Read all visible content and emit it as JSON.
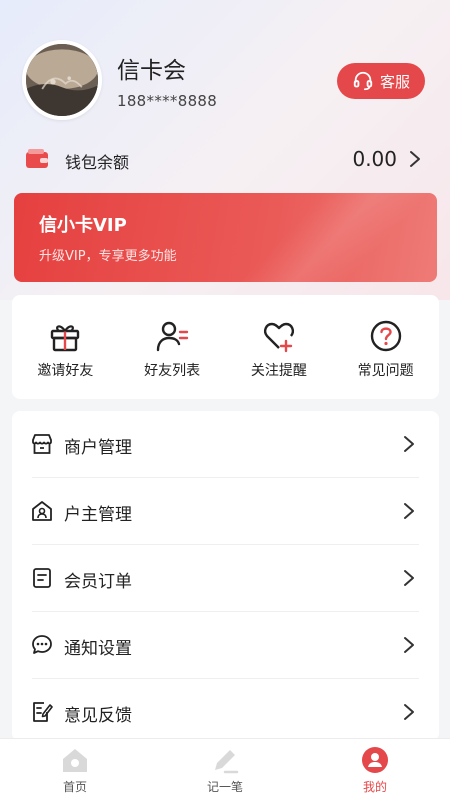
{
  "profile": {
    "name": "信卡会",
    "phone": "188****8888",
    "service_label": "客服"
  },
  "wallet": {
    "label": "钱包余额",
    "value": "0.00"
  },
  "vip": {
    "title": "信小卡VIP",
    "subtitle": "升级VIP，专享更多功能"
  },
  "quick_actions": [
    {
      "label": "邀请好友",
      "icon": "gift-icon"
    },
    {
      "label": "好友列表",
      "icon": "friends-list-icon"
    },
    {
      "label": "关注提醒",
      "icon": "heart-plus-icon"
    },
    {
      "label": "常见问题",
      "icon": "question-icon"
    }
  ],
  "menu": [
    {
      "label": "商户管理",
      "icon": "store-icon"
    },
    {
      "label": "户主管理",
      "icon": "house-user-icon"
    },
    {
      "label": "会员订单",
      "icon": "order-icon"
    },
    {
      "label": "通知设置",
      "icon": "chat-bubble-icon"
    },
    {
      "label": "意见反馈",
      "icon": "feedback-edit-icon"
    }
  ],
  "tabs": [
    {
      "label": "首页",
      "icon": "home-icon",
      "active": false
    },
    {
      "label": "记一笔",
      "icon": "pencil-icon",
      "active": false
    },
    {
      "label": "我的",
      "icon": "user-circle-icon",
      "active": true
    }
  ],
  "colors": {
    "accent": "#e5484a",
    "vip_gradient_start": "#e5403f",
    "vip_gradient_end": "#ee7b77",
    "inactive_icon": "#d9d9d9"
  }
}
